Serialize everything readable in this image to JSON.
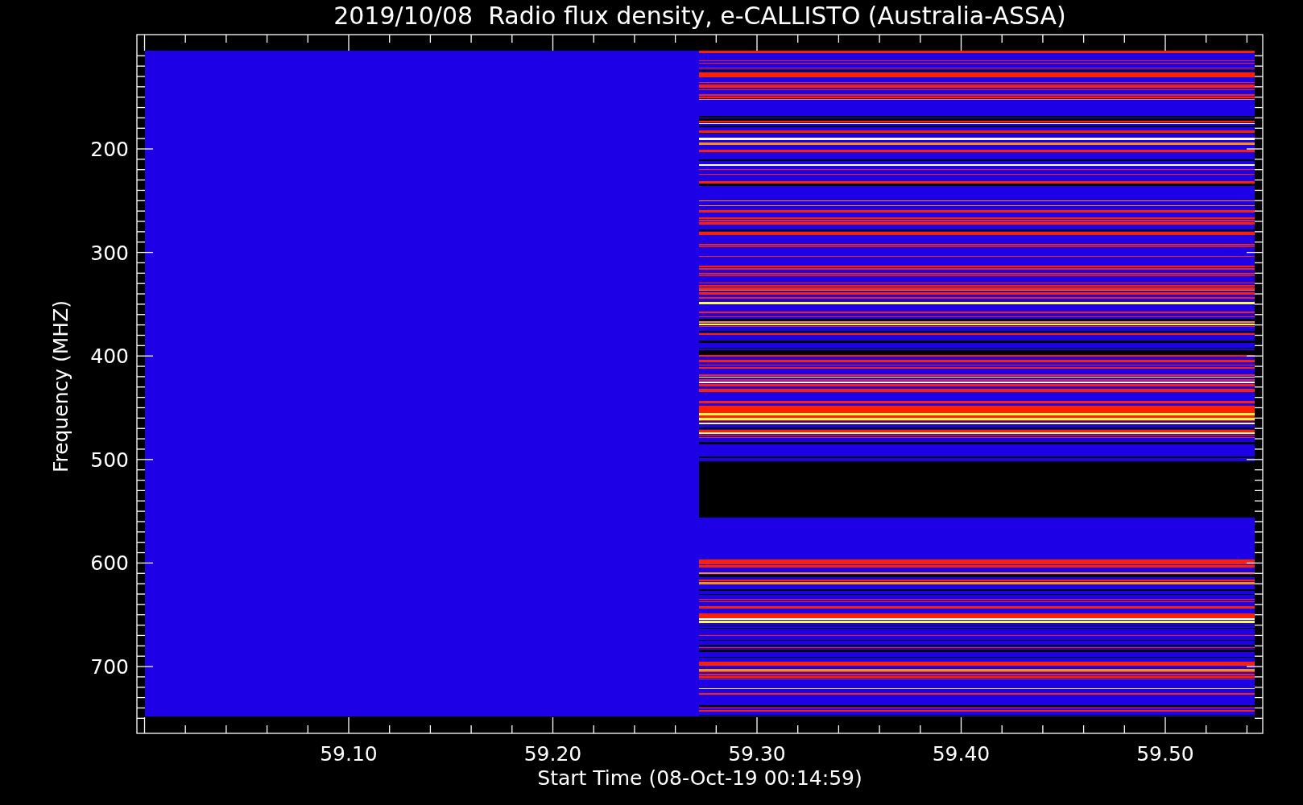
{
  "title": "2019/10/08  Radio flux density, e-CALLISTO (Australia-ASSA)",
  "y_axis": {
    "label": "Frequency (MHZ)",
    "ticks": [
      "200",
      "300",
      "400",
      "500",
      "600",
      "700"
    ]
  },
  "x_axis": {
    "label": "Start Time (08-Oct-19 00:14:59)",
    "ticks": [
      "59.10",
      "59.20",
      "59.30",
      "59.40",
      "59.50"
    ]
  }
}
